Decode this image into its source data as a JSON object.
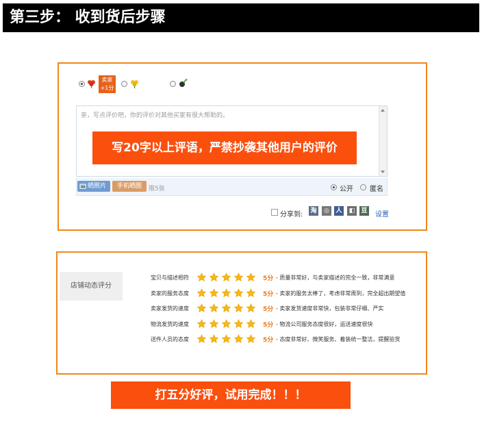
{
  "header": {
    "title": "第三步： 收到货后步骤"
  },
  "review": {
    "seller_badge": {
      "line1": "卖家",
      "line2": "+1分"
    },
    "placeholder": "亲，写点评价吧，你的评价对其他买家有很大帮助的。",
    "overlay": "写20字以上评语，严禁抄袭其他用户的评价",
    "photo_button": "晒照片",
    "phone_button": "手机晒图",
    "limit_text": "限5张",
    "visibility": {
      "public": "公开",
      "anonymous": "匿名"
    },
    "share": {
      "label": "分享到:",
      "settings": "设置",
      "icons": [
        "淘",
        "◎",
        "人",
        "◧",
        "豆"
      ]
    }
  },
  "rating": {
    "title": "店铺动态评分",
    "rows": [
      {
        "label": "宝贝与描述相符",
        "score": "5分",
        "desc": "- 质量非常好，与卖家描述的完全一致，非常满意",
        "stars": 5
      },
      {
        "label": "卖家的服务态度",
        "score": "5分",
        "desc": "- 卖家的服务太棒了，考虑非常周到，完全超出期望值",
        "stars": 5
      },
      {
        "label": "卖家发货的速度",
        "score": "5分",
        "desc": "- 卖家发货速度非常快，包装非常仔细、严实",
        "stars": 5
      },
      {
        "label": "物流发货的速度",
        "score": "5分",
        "desc": "- 物流公司服务态度很好，运送速度很快",
        "stars": 5
      },
      {
        "label": "送件人员的态度",
        "score": "5分",
        "desc": "- 态度非常好、微笑服务、着装统一整洁，提醒验货",
        "stars": 5
      }
    ]
  },
  "footer_banner": "打五分好评，试用完成！！！",
  "colors": {
    "accent": "#fb4f0e",
    "border": "#f0861a",
    "header_bg": "#000000"
  }
}
